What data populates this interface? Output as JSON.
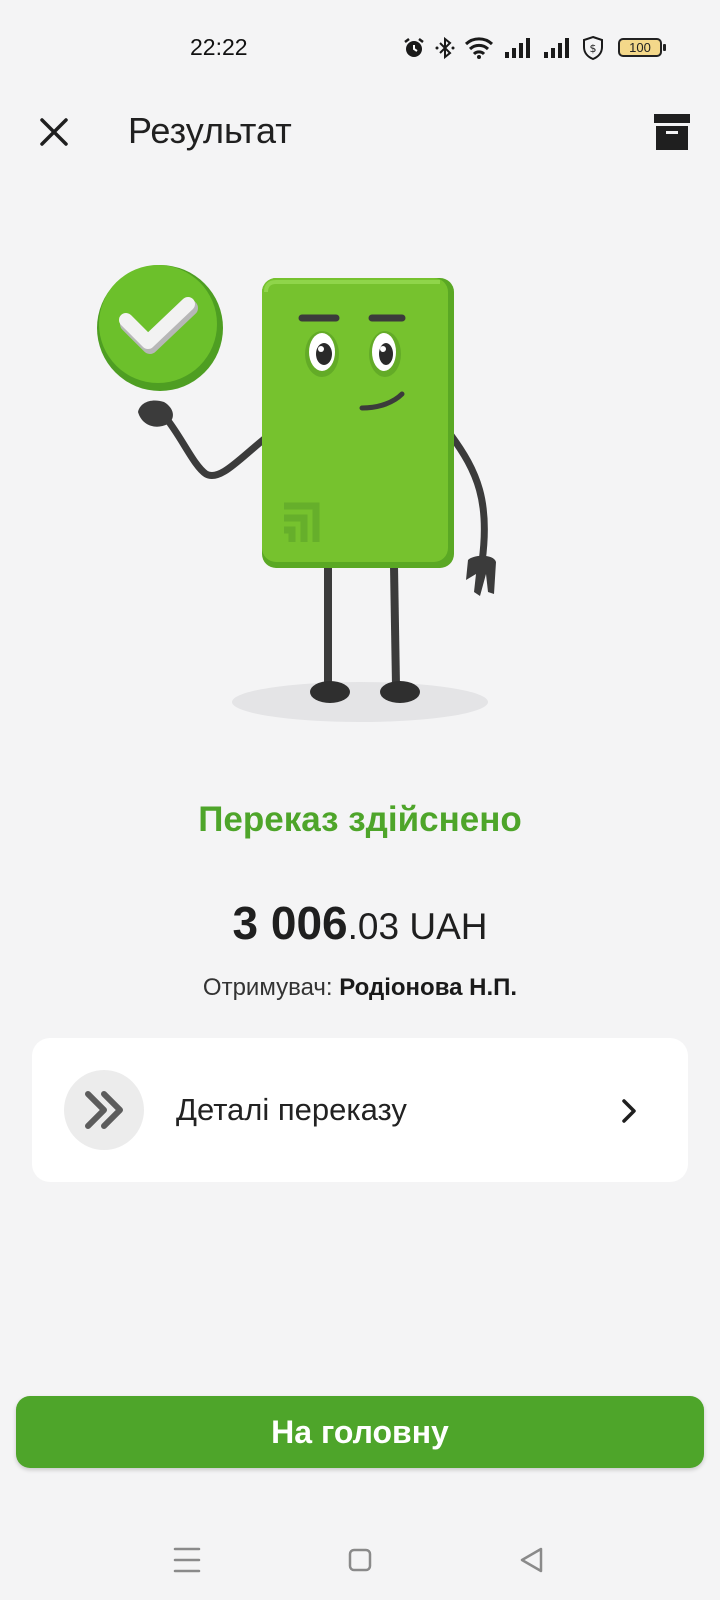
{
  "status_bar": {
    "time": "22:22",
    "icons": [
      "alarm-icon",
      "bluetooth-icon",
      "wifi-icon",
      "signal-icon",
      "signal-icon",
      "shield-dollar-icon"
    ],
    "battery": "100"
  },
  "header": {
    "title": "Результат",
    "close_icon": "close-icon",
    "archive_icon": "archive-icon"
  },
  "result": {
    "status": "Переказ здійснено",
    "amount_main": "3 006",
    "amount_cents": ".03",
    "currency": " UAH",
    "recipient_label": "Отримувач: ",
    "recipient_name": "Родіонова Н.П."
  },
  "details": {
    "label": "Деталі переказу",
    "icon": "double-chevron-right-icon",
    "chevron": "chevron-right-icon"
  },
  "actions": {
    "home_label": "На головну"
  },
  "nav_bar": {
    "items": [
      "menu-icon",
      "home-square-icon",
      "back-triangle-icon"
    ]
  },
  "colors": {
    "accent_green": "#4ea52a",
    "card_green": "#76c22e",
    "background": "#f4f4f5"
  }
}
